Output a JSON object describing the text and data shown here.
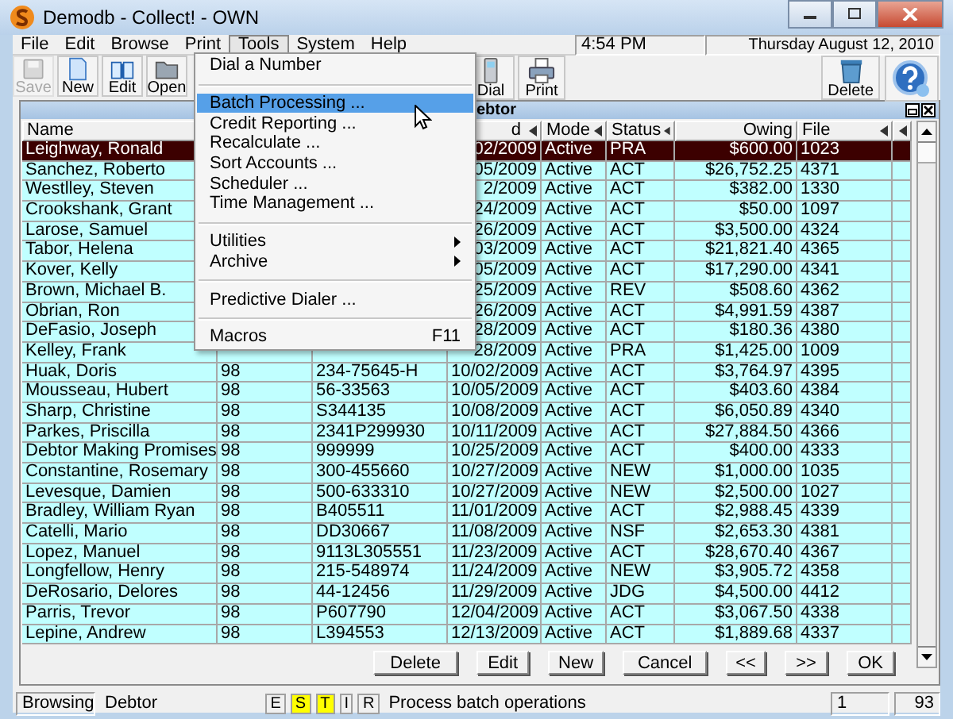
{
  "window": {
    "title": "Demodb - Collect! - OWN"
  },
  "menu_bar": [
    {
      "label": "File",
      "selected": false
    },
    {
      "label": "Edit",
      "selected": false
    },
    {
      "label": "Browse",
      "selected": false
    },
    {
      "label": "Print",
      "selected": false
    },
    {
      "label": "Tools",
      "selected": true
    },
    {
      "label": "System",
      "selected": false
    },
    {
      "label": "Help",
      "selected": false
    }
  ],
  "clock": {
    "time": "4:54 PM",
    "date": "Thursday  August 12, 2010"
  },
  "toolbar_left": [
    {
      "kind": "save",
      "label": "Save",
      "disabled": true
    },
    {
      "kind": "new",
      "label": "New",
      "disabled": false
    },
    {
      "kind": "edit",
      "label": "Edit",
      "disabled": false
    },
    {
      "kind": "open",
      "label": "Open",
      "disabled": false
    }
  ],
  "toolbar_middle": [
    {
      "kind": "dial",
      "label": "Dial",
      "disabled": false
    },
    {
      "kind": "print",
      "label": "Print",
      "disabled": false
    }
  ],
  "toolbar_right": [
    {
      "kind": "delete",
      "label": "Delete",
      "disabled": false
    },
    {
      "kind": "help",
      "disabled": false
    }
  ],
  "tools_menu": [
    {
      "kind": "item",
      "label": "Dial a Number",
      "selected": false
    },
    {
      "kind": "separator"
    },
    {
      "kind": "item",
      "label": "Batch Processing ...",
      "selected": true
    },
    {
      "kind": "item",
      "label": "Credit Reporting ...",
      "selected": false
    },
    {
      "kind": "item",
      "label": "Recalculate ...",
      "selected": false
    },
    {
      "kind": "item",
      "label": "Sort Accounts ...",
      "selected": false
    },
    {
      "kind": "item",
      "label": "Scheduler ...",
      "selected": false
    },
    {
      "kind": "item",
      "label": "Time Management ...",
      "selected": false
    },
    {
      "kind": "separator"
    },
    {
      "kind": "submenu",
      "label": "Utilities",
      "selected": false
    },
    {
      "kind": "submenu",
      "label": "Archive",
      "selected": false
    },
    {
      "kind": "separator"
    },
    {
      "kind": "item",
      "label": "Predictive Dialer ...",
      "selected": false
    },
    {
      "kind": "separator"
    },
    {
      "kind": "item",
      "label": "Macros",
      "shortcut": "F11",
      "selected": false
    }
  ],
  "record_window": {
    "title": "ebtor",
    "columns": [
      {
        "label": "Name"
      },
      {},
      {},
      {
        "label": "d",
        "sort_arrow": true
      },
      {
        "label": "Mode",
        "sort_arrow": true
      },
      {
        "label": "Status",
        "sort_arrow": true
      },
      {
        "label": "Owing",
        "sort_arrow": false
      },
      {
        "label": "File",
        "sort_arrow": true
      },
      {
        "sort_arrow": true
      }
    ],
    "rows": [
      {
        "name": "Leighway, Ronald",
        "column_4": "02/2009",
        "mode": "Active",
        "status": "PRA",
        "owing": "$600.00",
        "file": "1023",
        "selected": true
      },
      {
        "name": "Sanchez, Roberto",
        "column_4": "05/2009",
        "mode": "Active",
        "status": "ACT",
        "owing": "$26,752.25",
        "file": "4371",
        "selected": false
      },
      {
        "name": "Westlley, Steven",
        "column_4": "2/2009",
        "mode": "Active",
        "status": "ACT",
        "owing": "$382.00",
        "file": "1330",
        "selected": false
      },
      {
        "name": "Crookshank, Grant",
        "column_4": "24/2009",
        "mode": "Active",
        "status": "ACT",
        "owing": "$50.00",
        "file": "1097",
        "selected": false
      },
      {
        "name": "Larose, Samuel",
        "column_4": "26/2009",
        "mode": "Active",
        "status": "ACT",
        "owing": "$3,500.00",
        "file": "4324",
        "selected": false
      },
      {
        "name": "Tabor, Helena",
        "column_4": "03/2009",
        "mode": "Active",
        "status": "ACT",
        "owing": "$21,821.40",
        "file": "4365",
        "selected": false
      },
      {
        "name": "Kover, Kelly",
        "column_4": "05/2009",
        "mode": "Active",
        "status": "ACT",
        "owing": "$17,290.00",
        "file": "4341",
        "selected": false
      },
      {
        "name": "Brown, Michael B.",
        "column_4": "25/2009",
        "mode": "Active",
        "status": "REV",
        "owing": "$508.60",
        "file": "4362",
        "selected": false
      },
      {
        "name": "Obrian, Ron",
        "column_4": "26/2009",
        "mode": "Active",
        "status": "ACT",
        "owing": "$4,991.59",
        "file": "4387",
        "selected": false
      },
      {
        "name": "DeFasio, Joseph",
        "column_4": "28/2009",
        "mode": "Active",
        "status": "ACT",
        "owing": "$180.36",
        "file": "4380",
        "selected": false
      },
      {
        "name": "Kelley, Frank",
        "column_4": "28/2009",
        "mode": "Active",
        "status": "PRA",
        "owing": "$1,425.00",
        "file": "1009",
        "selected": false
      },
      {
        "name": "Huak, Doris",
        "column_2": "98",
        "column_3": "234-75645-H",
        "column_4": "10/02/2009",
        "mode": "Active",
        "status": "ACT",
        "owing": "$3,764.97",
        "file": "4395",
        "selected": false
      },
      {
        "name": "Mousseau, Hubert",
        "column_2": "98",
        "column_3": "56-33563",
        "column_4": "10/05/2009",
        "mode": "Active",
        "status": "ACT",
        "owing": "$403.60",
        "file": "4384",
        "selected": false
      },
      {
        "name": "Sharp, Christine",
        "column_2": "98",
        "column_3": "S344135",
        "column_4": "10/08/2009",
        "mode": "Active",
        "status": "ACT",
        "owing": "$6,050.89",
        "file": "4340",
        "selected": false
      },
      {
        "name": "Parkes, Priscilla",
        "column_2": "98",
        "column_3": "2341P299930",
        "column_4": "10/11/2009",
        "mode": "Active",
        "status": "ACT",
        "owing": "$27,884.50",
        "file": "4366",
        "selected": false
      },
      {
        "name": "Debtor Making Promises",
        "column_2": "98",
        "column_3": "999999",
        "column_4": "10/25/2009",
        "mode": "Active",
        "status": "ACT",
        "owing": "$400.00",
        "file": "4333",
        "selected": false
      },
      {
        "name": "Constantine, Rosemary",
        "column_2": "98",
        "column_3": "300-455660",
        "column_4": "10/27/2009",
        "mode": "Active",
        "status": "NEW",
        "owing": "$1,000.00",
        "file": "1035",
        "selected": false
      },
      {
        "name": "Levesque, Damien",
        "column_2": "98",
        "column_3": "500-633310",
        "column_4": "10/27/2009",
        "mode": "Active",
        "status": "NEW",
        "owing": "$2,500.00",
        "file": "1027",
        "selected": false
      },
      {
        "name": "Bradley, William Ryan",
        "column_2": "98",
        "column_3": "B405511",
        "column_4": "11/01/2009",
        "mode": "Active",
        "status": "ACT",
        "owing": "$2,988.45",
        "file": "4339",
        "selected": false
      },
      {
        "name": "Catelli, Mario",
        "column_2": "98",
        "column_3": "DD30667",
        "column_4": "11/08/2009",
        "mode": "Active",
        "status": "NSF",
        "owing": "$2,653.30",
        "file": "4381",
        "selected": false
      },
      {
        "name": "Lopez, Manuel",
        "column_2": "98",
        "column_3": "9113L305551",
        "column_4": "11/23/2009",
        "mode": "Active",
        "status": "ACT",
        "owing": "$28,670.40",
        "file": "4367",
        "selected": false
      },
      {
        "name": "Longfellow, Henry",
        "column_2": "98",
        "column_3": "215-548974",
        "column_4": "11/24/2009",
        "mode": "Active",
        "status": "NEW",
        "owing": "$3,905.72",
        "file": "4358",
        "selected": false
      },
      {
        "name": "DeRosario, Delores",
        "column_2": "98",
        "column_3": "44-12456",
        "column_4": "11/29/2009",
        "mode": "Active",
        "status": "JDG",
        "owing": "$4,500.00",
        "file": "4412",
        "selected": false
      },
      {
        "name": "Parris, Trevor",
        "column_2": "98",
        "column_3": "P607790",
        "column_4": "12/04/2009",
        "mode": "Active",
        "status": "ACT",
        "owing": "$3,067.50",
        "file": "4338",
        "selected": false
      },
      {
        "name": "Lepine, Andrew",
        "column_2": "98",
        "column_3": "L394553",
        "column_4": "12/13/2009",
        "mode": "Active",
        "status": "ACT",
        "owing": "$1,889.68",
        "file": "4337",
        "selected": false
      }
    ],
    "buttons": [
      "Delete",
      "Edit",
      "New",
      "Cancel",
      "<<",
      ">>",
      "OK"
    ]
  },
  "status_bar": {
    "mode": "Browsing",
    "screen": "Debtor",
    "flags": [
      {
        "letter": "E",
        "on": false
      },
      {
        "letter": "S",
        "on": true
      },
      {
        "letter": "T",
        "on": true
      },
      {
        "letter": "I",
        "on": false
      },
      {
        "letter": "R",
        "on": false
      }
    ],
    "message": "Process batch operations",
    "record": "1",
    "count": "93"
  }
}
